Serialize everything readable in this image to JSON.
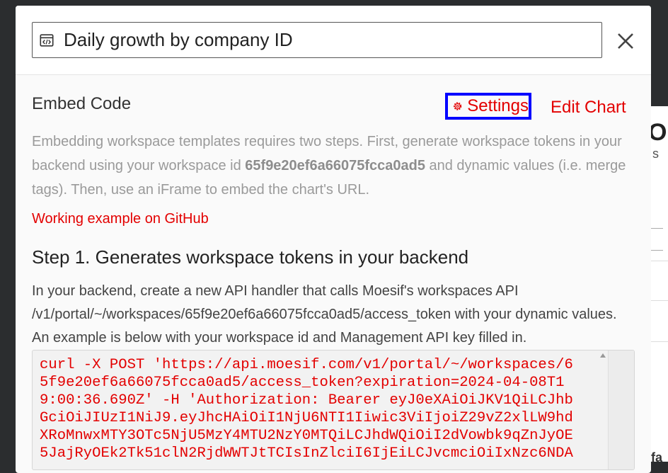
{
  "background": {
    "heading_fragment": "O",
    "sub_fragment": "s",
    "bottom_fragment": "fa"
  },
  "modal": {
    "title": "Daily growth by company ID",
    "title_icon": "embed-code-icon",
    "close_icon": "close-icon"
  },
  "embed": {
    "label": "Embed Code",
    "settings_label": "Settings",
    "settings_icon": "gear-icon",
    "edit_chart_label": "Edit Chart",
    "desc_part1": "Embedding workspace templates requires two steps. First, generate workspace tokens in your backend using your workspace id ",
    "workspace_id": "65f9e20ef6a66075fcca0ad5",
    "desc_part2": " and dynamic values (i.e. merge tags). Then, use an iFrame to embed the chart's URL.",
    "github_link": "Working example on GitHub"
  },
  "step1": {
    "title": "Step 1. Generates workspace tokens in your backend",
    "desc": "In your backend, create a new API handler that calls Moesif's workspaces API /v1/portal/~/workspaces/65f9e20ef6a66075fcca0ad5/access_token with your dynamic values. An example is below with your workspace id and Management API key filled in.",
    "code_lines": [
      "curl -X POST 'https://api.moesif.com/v1/portal/~/workspaces/6",
      "5f9e20ef6a66075fcca0ad5/access_token?expiration=2024-04-08T1",
      "9:00:36.690Z' -H 'Authorization: Bearer eyJ0eXAiOiJKV1QiLCJhb",
      "GciOiJIUzI1NiJ9.eyJhcHAiOiI1NjU6NTI1Iiwic3ViIjoiZ29vZ2xlLW9hd",
      "XRoMnwxMTY3OTc5NjU5MzY4MTU2NzY0MTQiLCJhdWQiOiI2dVowbk9qZnJyOE",
      "5JajRyOEk2Tk51clN2RjdWWTJtTCIsInZlciI6IjEiLCJvcmciOiIxNzc6NDA"
    ]
  },
  "colors": {
    "accent_red": "#e30000",
    "focus_blue": "#0000ff"
  }
}
